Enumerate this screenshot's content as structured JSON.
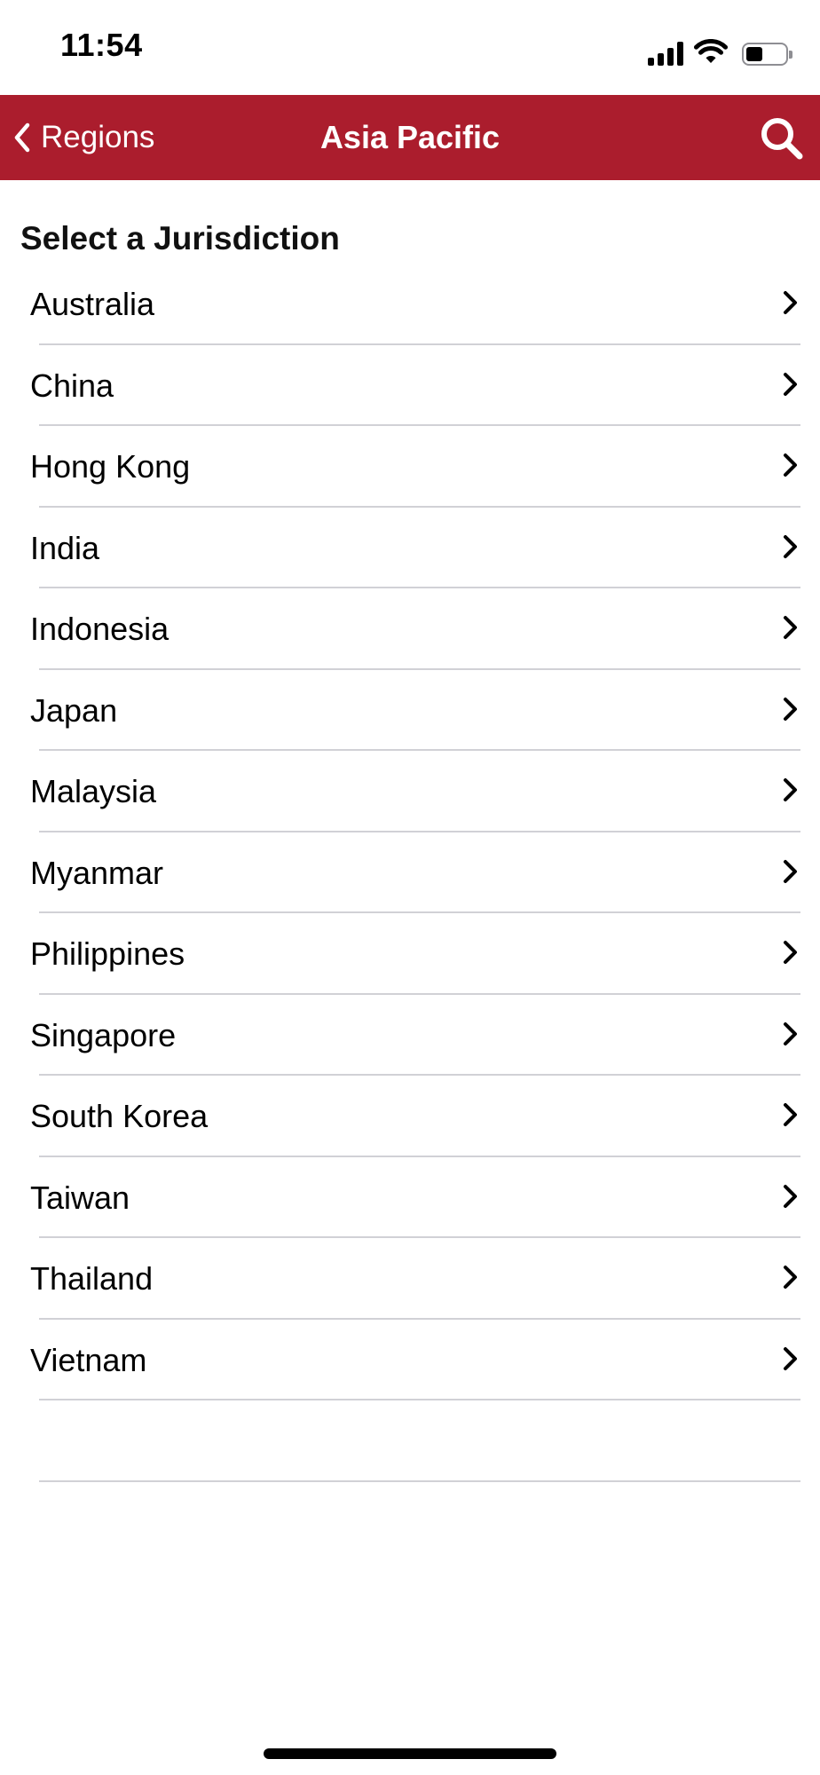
{
  "status_bar": {
    "time": "11:54",
    "icons": [
      "signal-icon",
      "wifi-icon",
      "battery-icon"
    ]
  },
  "nav": {
    "back_label": "Regions",
    "title": "Asia Pacific",
    "search_icon": "search-icon",
    "bar_color": "#ab1d2d"
  },
  "section_title": "Select a Jurisdiction",
  "jurisdictions": [
    {
      "label": "Australia"
    },
    {
      "label": "China"
    },
    {
      "label": "Hong Kong"
    },
    {
      "label": "India"
    },
    {
      "label": "Indonesia"
    },
    {
      "label": "Japan"
    },
    {
      "label": "Malaysia"
    },
    {
      "label": "Myanmar"
    },
    {
      "label": "Philippines"
    },
    {
      "label": "Singapore"
    },
    {
      "label": "South Korea"
    },
    {
      "label": "Taiwan"
    },
    {
      "label": "Thailand"
    },
    {
      "label": "Vietnam"
    }
  ]
}
